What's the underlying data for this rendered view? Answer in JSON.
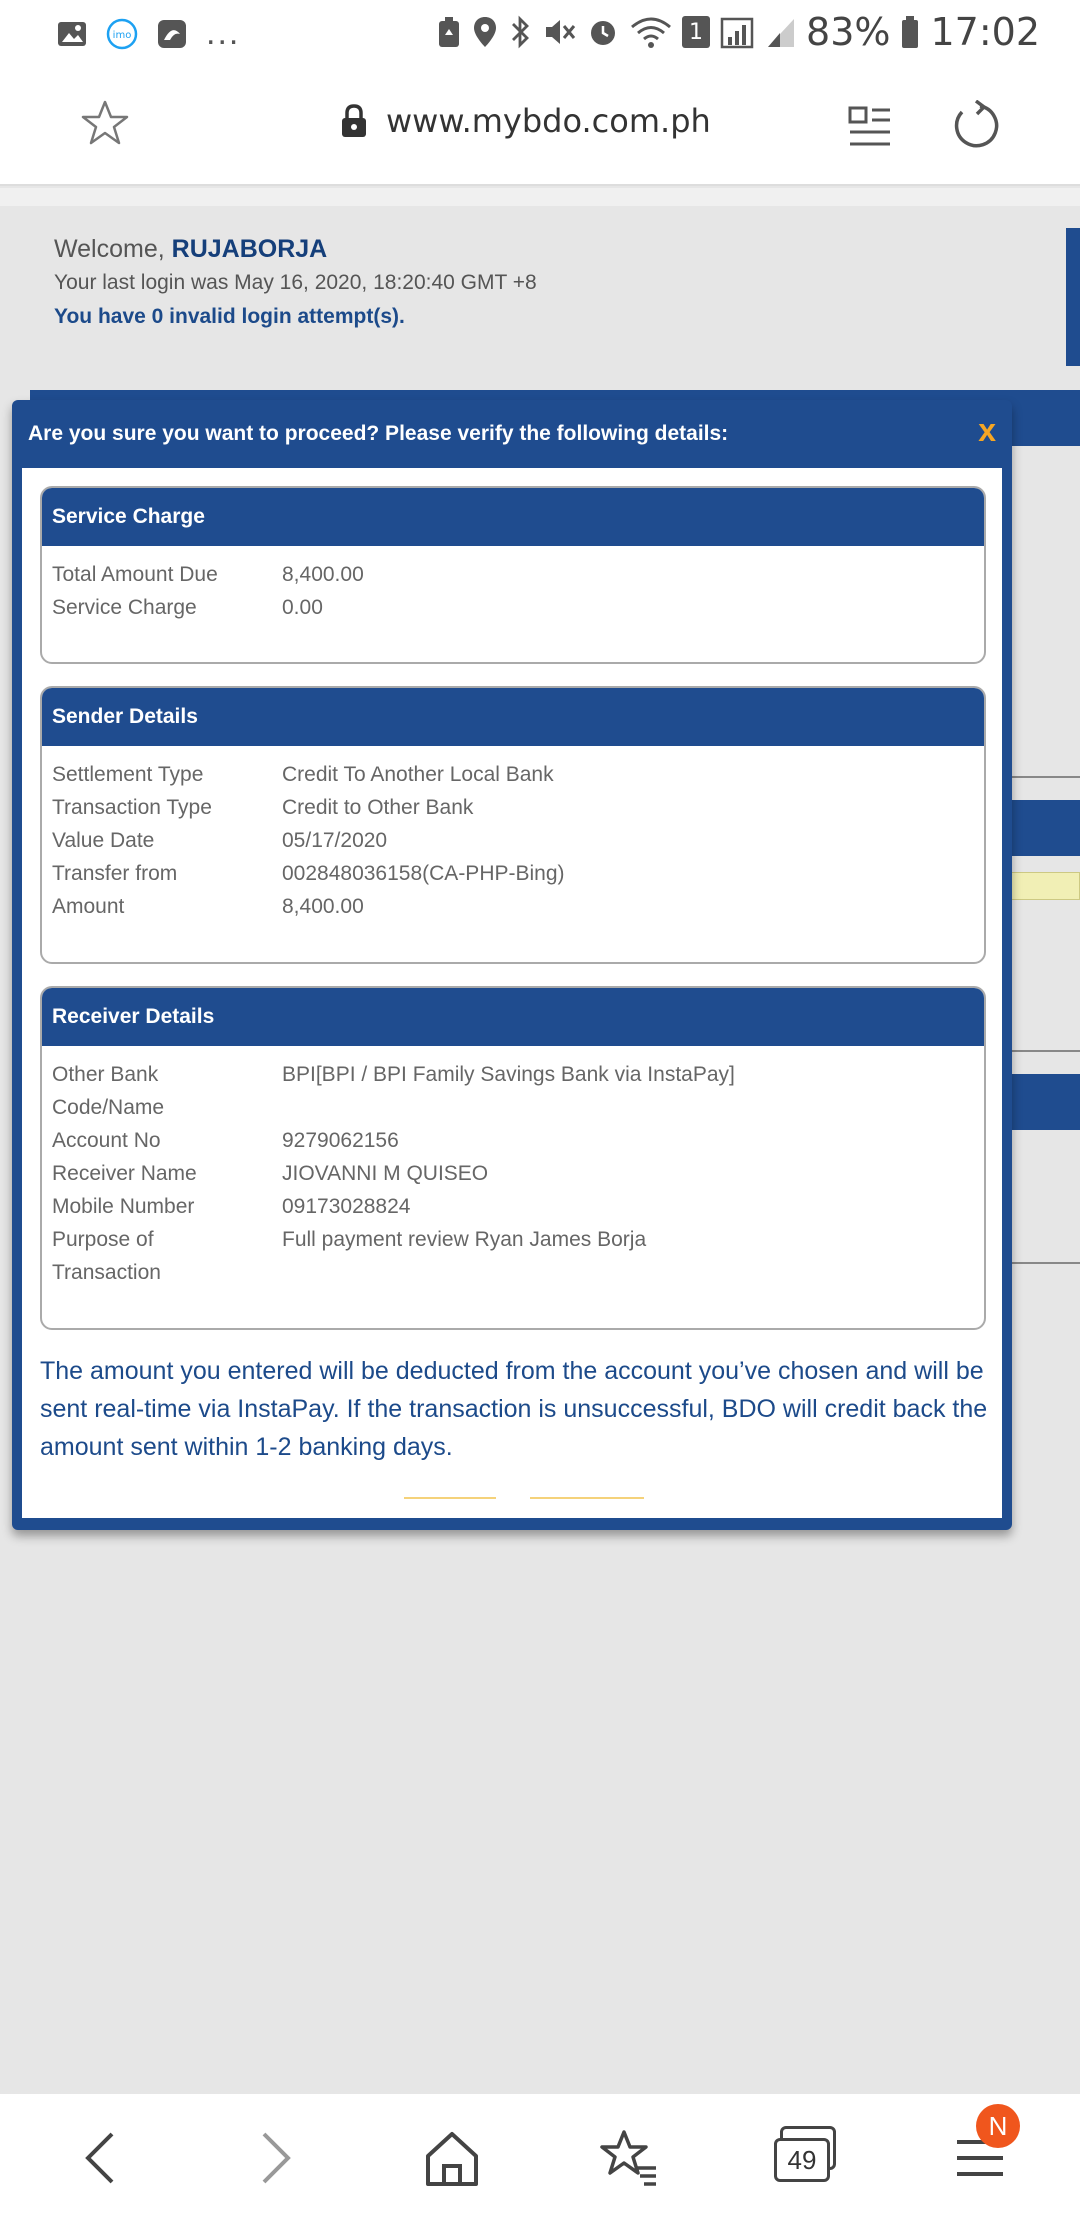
{
  "status_bar": {
    "battery": "83%",
    "time": "17:02",
    "notification_icons": [
      "gallery-icon",
      "imo-icon",
      "app-icon",
      "more-dots"
    ],
    "more": "...",
    "sim_badge": "1"
  },
  "url_bar": {
    "url": "www.mybdo.com.ph"
  },
  "welcome": {
    "prefix": "Welcome, ",
    "username": "RUJABORJA",
    "last_login": "Your last login was May 16, 2020, 18:20:40 GMT +8",
    "invalid_attempts": "You have 0 invalid login attempt(s)."
  },
  "modal": {
    "title": "Are you sure you want to proceed? Please verify the following details:",
    "close": "x",
    "service_charge": {
      "heading": "Service Charge",
      "rows": [
        {
          "k": "Total Amount Due",
          "v": "8,400.00"
        },
        {
          "k": "Service Charge",
          "v": "0.00"
        }
      ]
    },
    "sender": {
      "heading": "Sender Details",
      "rows": [
        {
          "k": "Settlement Type",
          "v": "Credit To Another Local Bank"
        },
        {
          "k": "Transaction Type",
          "v": "Credit to Other Bank"
        },
        {
          "k": "Value Date",
          "v": "05/17/2020"
        },
        {
          "k": "Transfer from",
          "v": "002848036158(CA-PHP-Bing)"
        },
        {
          "k": "Amount",
          "v": "8,400.00"
        }
      ]
    },
    "receiver": {
      "heading": "Receiver Details",
      "rows": [
        {
          "k": "Other Bank Code/Name",
          "v": "BPI[BPI / BPI Family Savings Bank via InstaPay]"
        },
        {
          "k": "Account No",
          "v": "9279062156"
        },
        {
          "k": "Receiver Name",
          "v": "JIOVANNI M QUISEO"
        },
        {
          "k": "Mobile Number",
          "v": "09173028824"
        },
        {
          "k": "Purpose of Transaction",
          "v": "Full payment review Ryan James Borja"
        }
      ]
    },
    "notice": "The amount you entered will be deducted from the account you’ve chosen and will be sent real-time via InstaPay. If the transaction is unsuccessful, BDO will credit back the amount sent within 1-2 banking days."
  },
  "bottom_nav": {
    "tab_count": "49",
    "menu_badge": "N"
  },
  "colors": {
    "bdo_blue": "#1f4c8f",
    "close_orange": "#f6a623",
    "badge_orange": "#f0561d"
  }
}
